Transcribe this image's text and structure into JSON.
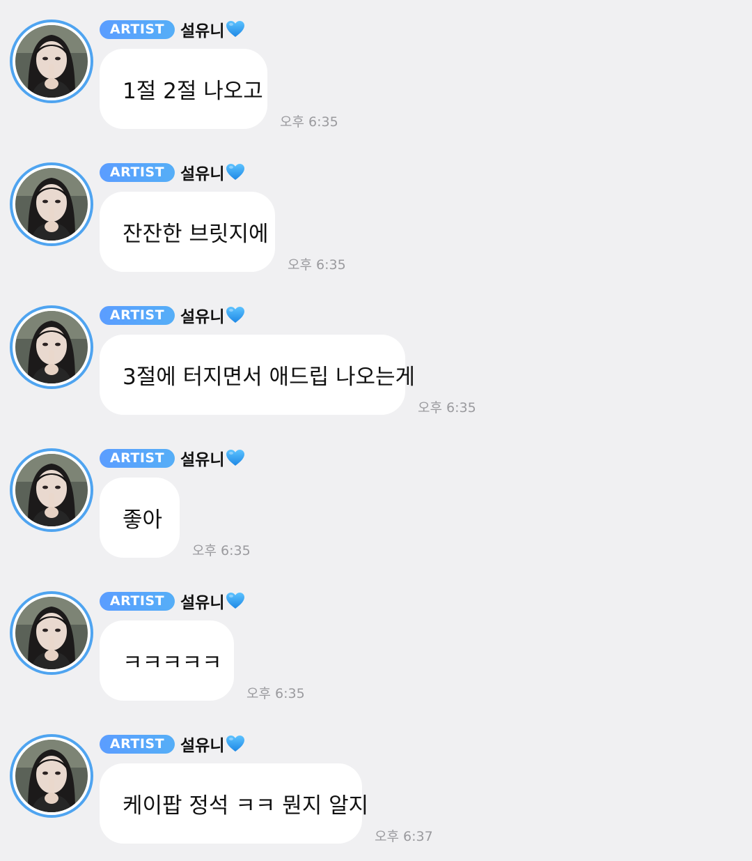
{
  "chat": {
    "accent_color": "#4fa4f0",
    "badge_color": "#5b9dff",
    "messages": [
      {
        "badge": "ARTIST",
        "sender": "설유니",
        "sender_emoji": "blue-heart-icon",
        "text": "1절 2절 나오고",
        "time": "오후 6:35"
      },
      {
        "badge": "ARTIST",
        "sender": "설유니",
        "sender_emoji": "blue-heart-icon",
        "text": "잔잔한 브릿지에",
        "time": "오후 6:35"
      },
      {
        "badge": "ARTIST",
        "sender": "설유니",
        "sender_emoji": "blue-heart-icon",
        "text": "3절에 터지면서 애드립 나오는게",
        "time": "오후 6:35"
      },
      {
        "badge": "ARTIST",
        "sender": "설유니",
        "sender_emoji": "blue-heart-icon",
        "text": "좋아",
        "time": "오후 6:35"
      },
      {
        "badge": "ARTIST",
        "sender": "설유니",
        "sender_emoji": "blue-heart-icon",
        "text": "ㅋㅋㅋㅋㅋ",
        "time": "오후 6:35"
      },
      {
        "badge": "ARTIST",
        "sender": "설유니",
        "sender_emoji": "blue-heart-icon",
        "text": "케이팝 정석 ㅋㅋ 뭔지 알지",
        "time": "오후 6:37"
      }
    ]
  }
}
